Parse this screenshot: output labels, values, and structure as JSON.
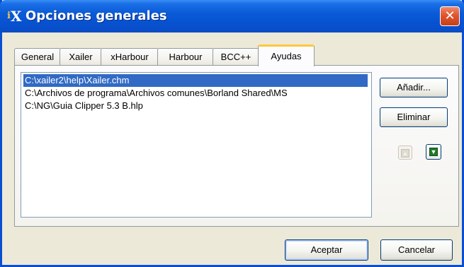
{
  "window": {
    "title": "Opciones generales",
    "icon_name": "xailer-app-icon",
    "icon_text": "X",
    "close_symbol": "✕"
  },
  "tabs": [
    {
      "label": "General",
      "active": false
    },
    {
      "label": "Xailer",
      "active": false
    },
    {
      "label": "xHarbour",
      "active": false
    },
    {
      "label": "Harbour",
      "active": false
    },
    {
      "label": "BCC++",
      "active": false
    },
    {
      "label": "Ayudas",
      "active": true
    }
  ],
  "help_list": {
    "items": [
      {
        "text": "C:\\xailer2\\help\\Xailer.chm",
        "selected": true
      },
      {
        "text": "C:\\Archivos de programa\\Archivos comunes\\Borland Shared\\MS",
        "selected": false
      },
      {
        "text": "C:\\NG\\Guia Clipper 5.3 B.hlp",
        "selected": false
      }
    ]
  },
  "side_buttons": {
    "add_label": "Añadir...",
    "remove_label": "Eliminar",
    "move_up": {
      "icon": "arrow-up-icon",
      "enabled": false
    },
    "move_down": {
      "icon": "arrow-down-icon",
      "enabled": true
    }
  },
  "footer": {
    "accept_label": "Aceptar",
    "cancel_label": "Cancelar"
  },
  "colors": {
    "title_bar": "#0a5bd8",
    "selection": "#316ac5",
    "active_tab_accent": "#ffc83c",
    "close_button": "#e0552e"
  }
}
